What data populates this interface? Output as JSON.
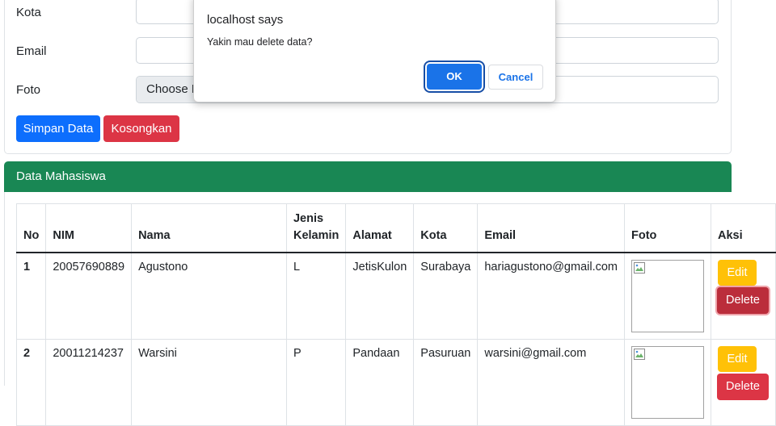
{
  "form": {
    "fields": [
      {
        "label": "Kota",
        "value": ""
      },
      {
        "label": "Email",
        "value": ""
      },
      {
        "label": "Foto",
        "file_button": "Choose F"
      }
    ],
    "save_button": "Simpan Data",
    "clear_button": "Kosongkan"
  },
  "data_card": {
    "title": "Data Mahasiswa",
    "columns": [
      "No",
      "NIM",
      "Nama",
      "Jenis Kelamin",
      "Alamat",
      "Kota",
      "Email",
      "Foto",
      "Aksi"
    ],
    "rows": [
      {
        "no": "1",
        "nim": "20057690889",
        "nama": "Agustono",
        "jk": "L",
        "alamat": "JetisKulon",
        "kota": "Surabaya",
        "email": "hariagustono@gmail.com"
      },
      {
        "no": "2",
        "nim": "20011214237",
        "nama": "Warsini",
        "jk": "P",
        "alamat": "Pandaan",
        "kota": "Pasuruan",
        "email": "warsini@gmail.com"
      }
    ],
    "edit_label": "Edit",
    "delete_label": "Delete"
  },
  "dialog": {
    "title": "localhost says",
    "message": "Yakin mau delete data?",
    "ok_label": "OK",
    "cancel_label": "Cancel"
  },
  "colors": {
    "primary": "#0d6efd",
    "danger": "#dc3545",
    "success_header": "#198754",
    "warning": "#ffc107",
    "dialog_ok": "#1a73e8"
  },
  "icons": [
    "broken-image-icon"
  ]
}
